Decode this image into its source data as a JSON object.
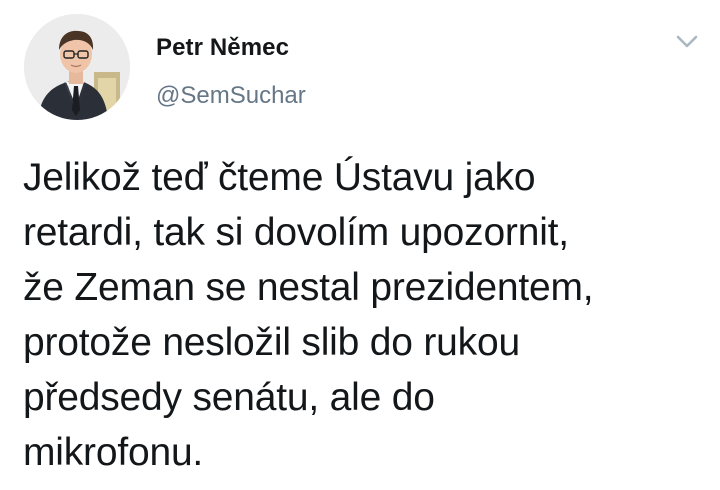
{
  "author": {
    "name": "Petr Němec",
    "handle": "@SemSuchar",
    "avatar_icon": "profile-photo-man-in-suit"
  },
  "menu": {
    "icon": "chevron-down-icon",
    "color": "#aab8c2"
  },
  "tweet": {
    "lines": [
      "Jelikož teď čteme Ústavu jako",
      "retardi, tak si dovolím upozornit,",
      "že Zeman se nestal prezidentem,",
      "protože nesložil slib do rukou",
      "předsedy senátu, ale do",
      "mikrofonu."
    ]
  },
  "colors": {
    "text": "#14171a",
    "secondary": "#657786"
  }
}
